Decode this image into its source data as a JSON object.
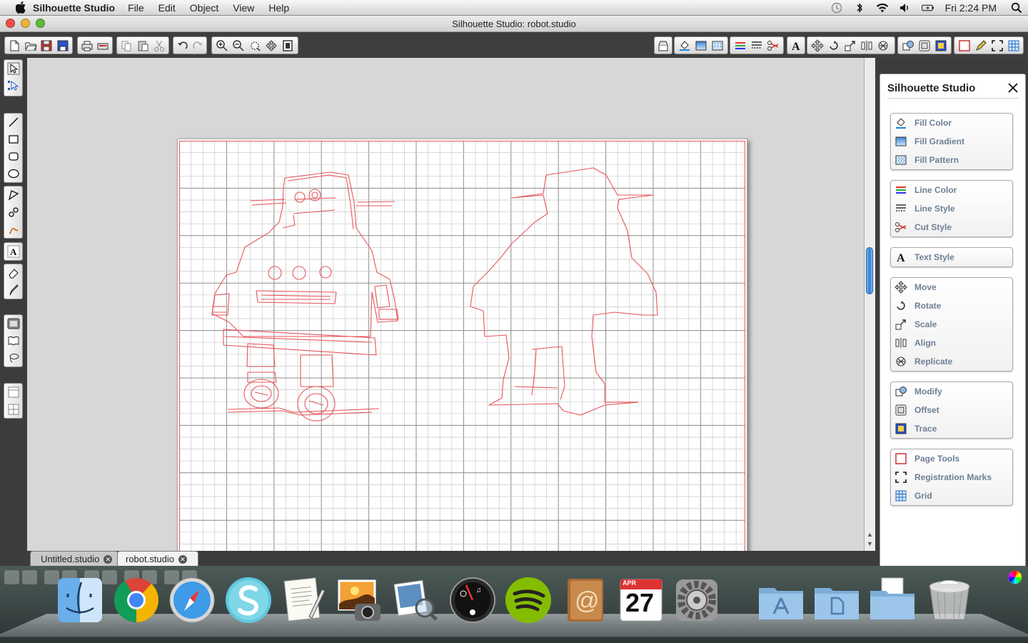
{
  "menubar": {
    "app_name": "Silhouette Studio",
    "items": [
      "File",
      "Edit",
      "Object",
      "View",
      "Help"
    ],
    "clock": "Fri 2:24 PM"
  },
  "window": {
    "title": "Silhouette Studio: robot.studio"
  },
  "tabs": [
    {
      "label": "Untitled.studio",
      "active": false
    },
    {
      "label": "robot.studio",
      "active": true
    }
  ],
  "panel": {
    "title": "Silhouette Studio",
    "groups": [
      [
        {
          "label": "Fill Color",
          "icon": "fill-color-icon"
        },
        {
          "label": "Fill Gradient",
          "icon": "fill-gradient-icon"
        },
        {
          "label": "Fill Pattern",
          "icon": "fill-pattern-icon"
        }
      ],
      [
        {
          "label": "Line Color",
          "icon": "line-color-icon"
        },
        {
          "label": "Line Style",
          "icon": "line-style-icon"
        },
        {
          "label": "Cut Style",
          "icon": "cut-style-icon"
        }
      ],
      [
        {
          "label": "Text Style",
          "icon": "text-style-icon"
        }
      ],
      [
        {
          "label": "Move",
          "icon": "move-icon"
        },
        {
          "label": "Rotate",
          "icon": "rotate-icon"
        },
        {
          "label": "Scale",
          "icon": "scale-icon"
        },
        {
          "label": "Align",
          "icon": "align-icon"
        },
        {
          "label": "Replicate",
          "icon": "replicate-icon"
        }
      ],
      [
        {
          "label": "Modify",
          "icon": "modify-icon"
        },
        {
          "label": "Offset",
          "icon": "offset-icon"
        },
        {
          "label": "Trace",
          "icon": "trace-icon"
        }
      ],
      [
        {
          "label": "Page Tools",
          "icon": "page-tools-icon"
        },
        {
          "label": "Registration Marks",
          "icon": "registration-marks-icon"
        },
        {
          "label": "Grid",
          "icon": "grid-icon"
        }
      ]
    ]
  },
  "dock": {
    "calendar_month": "APR",
    "calendar_day": "27"
  },
  "colors": {
    "cut_line": "#e8555a",
    "grid_minor": "#c9c9c9",
    "grid_major": "#8c8c8c",
    "scroll_accent": "#2f7fd6"
  }
}
